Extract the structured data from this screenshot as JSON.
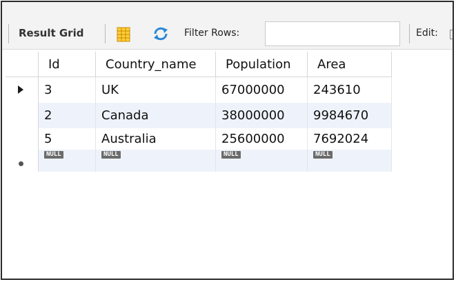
{
  "toolbar": {
    "result_grid_label": "Result Grid",
    "filter_rows_label": "Filter Rows:",
    "filter_value": "",
    "edit_label": "Edit:",
    "grid_icon": "form-grid-icon",
    "refresh_icon": "refresh-icon"
  },
  "grid": {
    "columns": [
      "Id",
      "Country_name",
      "Population",
      "Area"
    ],
    "rows": [
      {
        "id": "3",
        "country_name": "UK",
        "population": "67000000",
        "area": "243610",
        "indicator": "current-row-arrow"
      },
      {
        "id": "2",
        "country_name": "Canada",
        "population": "38000000",
        "area": "9984670",
        "indicator": ""
      },
      {
        "id": "5",
        "country_name": "Australia",
        "population": "25600000",
        "area": "7692024",
        "indicator": ""
      }
    ],
    "new_row": {
      "id": "NULL",
      "country_name": "NULL",
      "population": "NULL",
      "area": "NULL",
      "indicator": "new-row-star"
    }
  },
  "colors": {
    "toolbar_bg": "#f3f3f3",
    "alt_row_bg": "#eef3fb",
    "null_badge_bg": "#6b6b6b"
  }
}
